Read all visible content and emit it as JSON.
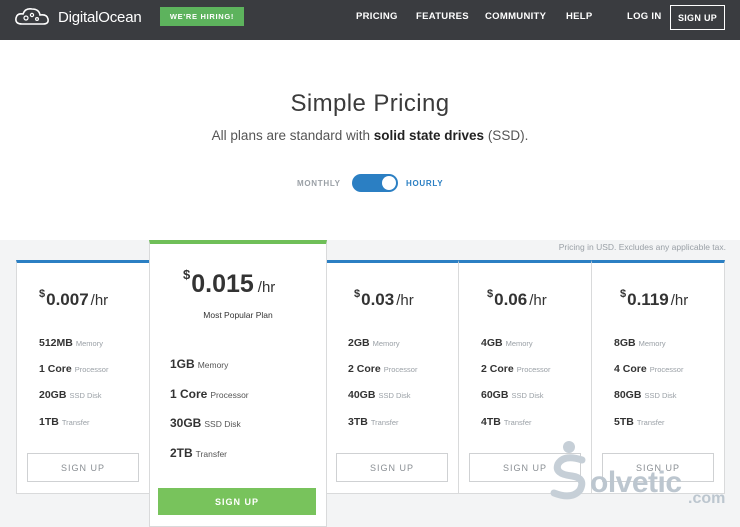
{
  "header": {
    "brand": "DigitalOcean",
    "hiring_badge": "WE'RE HIRING!",
    "nav": [
      "PRICING",
      "FEATURES",
      "COMMUNITY",
      "HELP"
    ],
    "login": "LOG IN",
    "signup": "SIGN UP"
  },
  "hero": {
    "title": "Simple Pricing",
    "subtitle_pre": "All plans are standard with ",
    "subtitle_bold": "solid state drives",
    "subtitle_post": " (SSD).",
    "toggle_left": "MONTHLY",
    "toggle_right": "HOURLY",
    "toggle_state": "hourly"
  },
  "tax_note": "Pricing in USD. Excludes any applicable tax.",
  "plans": [
    {
      "currency": "$",
      "price": "0.007",
      "unit": "/hr",
      "memory": "512MB",
      "processor": "1 Core",
      "disk": "20GB",
      "transfer": "1TB",
      "button": "SIGN UP"
    },
    {
      "currency": "$",
      "price": "0.015",
      "unit": "/hr",
      "tag": "Most Popular Plan",
      "memory": "1GB",
      "processor": "1 Core",
      "disk": "30GB",
      "transfer": "2TB",
      "button": "SIGN UP"
    },
    {
      "currency": "$",
      "price": "0.03",
      "unit": "/hr",
      "memory": "2GB",
      "processor": "2 Core",
      "disk": "40GB",
      "transfer": "3TB",
      "button": "SIGN UP"
    },
    {
      "currency": "$",
      "price": "0.06",
      "unit": "/hr",
      "memory": "4GB",
      "processor": "2 Core",
      "disk": "60GB",
      "transfer": "4TB",
      "button": "SIGN UP"
    },
    {
      "currency": "$",
      "price": "0.119",
      "unit": "/hr",
      "memory": "8GB",
      "processor": "4 Core",
      "disk": "80GB",
      "transfer": "5TB",
      "button": "SIGN UP"
    }
  ],
  "labels": {
    "memory": "Memory",
    "processor": "Processor",
    "disk": "SSD Disk",
    "transfer": "Transfer"
  },
  "watermark": {
    "text": "olvetic",
    "domain": ".com"
  },
  "colors": {
    "header_bg": "#3a3c40",
    "accent_blue": "#2b7fc3",
    "accent_green": "#6fbf58"
  }
}
